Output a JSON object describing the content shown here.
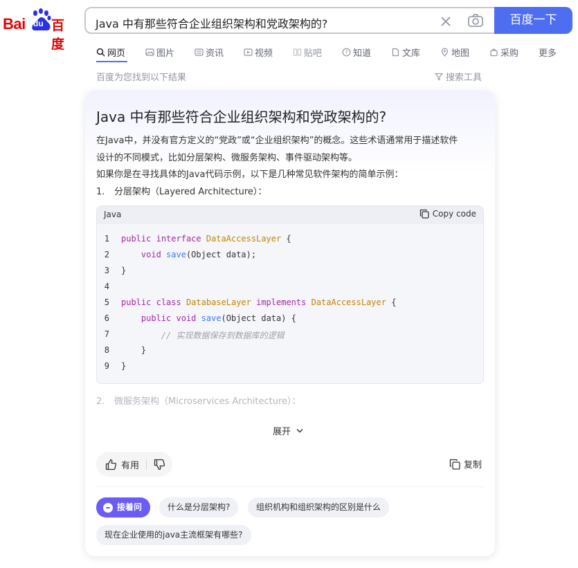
{
  "brand": {
    "logo_latin": "Bai",
    "logo_du": "du",
    "logo_cn": "百度"
  },
  "search": {
    "query": "Java 中有那些符合企业组织架构和党政架构的?",
    "button_label": "百度一下"
  },
  "tabs": [
    {
      "label": "网页",
      "icon": "search-icon",
      "active": true
    },
    {
      "label": "图片",
      "icon": "image-icon"
    },
    {
      "label": "资讯",
      "icon": "news-icon"
    },
    {
      "label": "视频",
      "icon": "video-icon"
    },
    {
      "label": "贴吧",
      "icon": "tieba-icon"
    },
    {
      "label": "知道",
      "icon": "question-icon"
    },
    {
      "label": "文库",
      "icon": "doc-icon"
    },
    {
      "label": "地图",
      "icon": "map-icon"
    },
    {
      "label": "采购",
      "icon": "shop-icon"
    },
    {
      "label": "更多"
    }
  ],
  "result_count": "百度为您找到以下结果",
  "search_tools": "搜索工具",
  "answer": {
    "title": "Java 中有那些符合企业组织架构和党政架构的?",
    "para1_line1": "在Java中，并没有官方定义的“党政”或“企业组织架构”的概念。这些术语通常用于描述软件",
    "para1_line2": "设计的不同模式，比如分层架构、微服务架构、事件驱动架构等。",
    "para2": "如果你是在寻找具体的Java代码示例，以下是几种常见软件架构的简单示例：",
    "item1_num": "1.",
    "item1_text": "分层架构（Layered Architecture）：",
    "item2_num": "2.",
    "item2_text": "微服务架构（Microservices Architecture）：",
    "code": {
      "lang": "Java",
      "copy_label": "Copy code",
      "line_numbers": [
        "1",
        "2",
        "3",
        "4",
        "5",
        "6",
        "7",
        "8",
        "9"
      ],
      "tokens": {
        "public": "public",
        "interface": "interface",
        "class": "class",
        "implements": "implements",
        "void": "void",
        "DataAccessLayer": "DataAccessLayer",
        "DatabaseLayer": "DatabaseLayer",
        "save": "save",
        "param": "(Object data);",
        "param_open": "(Object data) {",
        "brace_open": " {",
        "brace_close": "}",
        "comment": "// 实现数据保存到数据库的逻辑"
      }
    },
    "expand_label": "展开",
    "useful_label": "有用",
    "copy_label": "复制"
  },
  "followups": {
    "primary": "接着问",
    "chips": [
      "什么是分层架构?",
      "组织机构和组织架构的区别是什么",
      "现在企业使用的java主流框架有哪些?"
    ]
  },
  "colors": {
    "brand_red": "#e10602",
    "brand_blue": "#4e6ef2",
    "chip_purple": "#6b5cf5"
  }
}
